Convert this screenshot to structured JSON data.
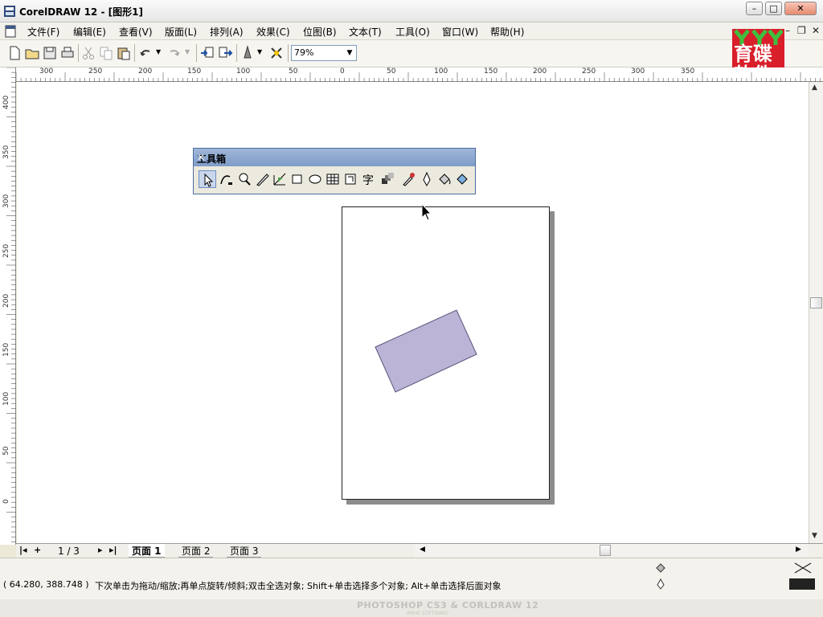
{
  "window": {
    "title": "CorelDRAW 12 - [图形1]",
    "buttons": {
      "minimize": "–",
      "maximize": "□",
      "close": "✕"
    }
  },
  "menu": {
    "items": [
      "文件(F)",
      "编辑(E)",
      "查看(V)",
      "版面(L)",
      "排列(A)",
      "效果(C)",
      "位图(B)",
      "文本(T)",
      "工具(O)",
      "窗口(W)",
      "帮助(H)"
    ],
    "doc_buttons": {
      "minimize": "–",
      "restore": "❐",
      "close": "✕"
    }
  },
  "toolbar": {
    "icons": [
      "new-icon",
      "open-icon",
      "save-icon",
      "print-icon",
      "cut-icon",
      "copy-icon",
      "paste-icon",
      "undo-icon",
      "redo-icon",
      "import-icon",
      "export-icon",
      "application-launcher-icon",
      "corel-online-icon"
    ],
    "zoom_value": "79%"
  },
  "rulers": {
    "horizontal_labels": [
      "300",
      "250",
      "200",
      "150",
      "100",
      "50",
      "0",
      "50",
      "100",
      "150",
      "200",
      "250",
      "300",
      "350"
    ],
    "vertical_labels": [
      "400",
      "350",
      "300",
      "250",
      "200",
      "150",
      "100",
      "50",
      "0"
    ]
  },
  "toolbox": {
    "title": "工具箱",
    "close": "✕",
    "tools": [
      "pick-tool-icon",
      "shape-tool-icon",
      "zoom-tool-icon",
      "freehand-tool-icon",
      "smart-fill-tool-icon",
      "rectangle-tool-icon",
      "ellipse-tool-icon",
      "polygon-tool-icon",
      "basic-shapes-tool-icon",
      "text-tool-icon",
      "interactive-blend-tool-icon",
      "eyedropper-tool-icon",
      "outline-tool-icon",
      "fill-tool-icon",
      "interactive-fill-tool-icon"
    ]
  },
  "canvas": {
    "shape_fill": "#bbb4d6",
    "shape_stroke": "#5a547c"
  },
  "pages": {
    "count": "1 / 3",
    "nav": {
      "first": "|◂",
      "add": "+",
      "next": "▸",
      "last": "▸|"
    },
    "tabs": [
      "页面 1",
      "页面 2",
      "页面 3"
    ],
    "active_index": 0
  },
  "status": {
    "coordinates": "( 64.280, 388.748 )",
    "hint": "下次单击为拖动/缩放;再单点旋转/倾斜;双击全选对象; Shift+单击选择多个对象; Alt+单击选择后面对象",
    "fill_color": "#222222"
  },
  "footer": {
    "text": "PHOTOSHOP CS3 & CORLDRAW 12",
    "subtext": "ANHE SOFTWARE"
  },
  "watermark": {
    "line1": "育碟",
    "line2": "软件"
  }
}
